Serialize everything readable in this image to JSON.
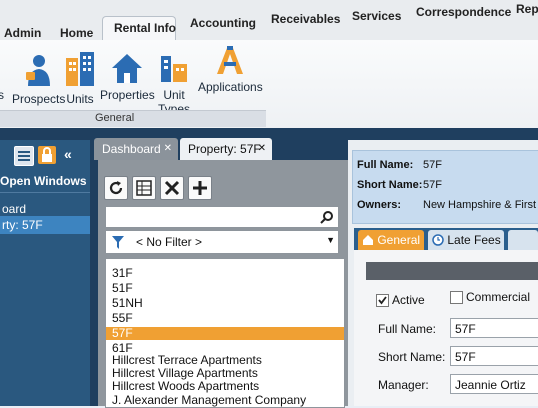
{
  "menu": {
    "tabs": [
      {
        "label": "Admin"
      },
      {
        "label": "Home"
      },
      {
        "label": "Rental Info"
      },
      {
        "label": "Accounting"
      },
      {
        "label": "Receivables"
      },
      {
        "label": "Services"
      },
      {
        "label": "Correspondence"
      },
      {
        "label": "Rep"
      }
    ]
  },
  "ribbon": {
    "buttons": [
      {
        "label": "s"
      },
      {
        "label": "Prospects"
      },
      {
        "label": "Units"
      },
      {
        "label": "Properties"
      },
      {
        "label": "Unit Types"
      },
      {
        "label": "Applications"
      }
    ],
    "group_label": "General",
    "colors": {
      "blue": "#2b6cb3",
      "orange": "#f0a033"
    }
  },
  "sidebar": {
    "open_windows_label": "Open Windows",
    "items": [
      {
        "label": "oard"
      },
      {
        "label": "rty: 57F"
      }
    ],
    "icons": [
      "list-icon",
      "lock-icon",
      "collapse-icon"
    ]
  },
  "doc_tabs": [
    {
      "label": "Dashboard",
      "close": "✕"
    },
    {
      "label": "Property: 57F",
      "close": "✕"
    }
  ],
  "search": {
    "icon": "search-icon",
    "value": ""
  },
  "filter": {
    "value": "< No Filter >"
  },
  "list": {
    "items": [
      {
        "label": "31F"
      },
      {
        "label": "51F"
      },
      {
        "label": "51NH"
      },
      {
        "label": "55F"
      },
      {
        "label": "57F"
      },
      {
        "label": "61F"
      },
      {
        "label": "Hillcrest Terrace Apartments"
      },
      {
        "label": "Hillcrest Village Apartments"
      },
      {
        "label": "Hillcrest Woods Apartments"
      },
      {
        "label": "J. Alexander Management Company"
      }
    ],
    "selected_index": 4
  },
  "info": {
    "full_name_label": "Full Name:",
    "full_name_value": "57F",
    "short_name_label": "Short Name:",
    "short_name_value": "57F",
    "owners_label": "Owners:",
    "owners_value": "New Hampshire & First I"
  },
  "right_tabs": [
    {
      "label": "General"
    },
    {
      "label": "Late Fees"
    }
  ],
  "form": {
    "active_label": "Active",
    "commercial_label": "Commercial",
    "full_name_label": "Full Name:",
    "full_name_value": "57F",
    "short_name_label": "Short Name:",
    "short_name_value": "57F",
    "manager_label": "Manager:",
    "manager_value": "Jeannie Ortiz"
  }
}
